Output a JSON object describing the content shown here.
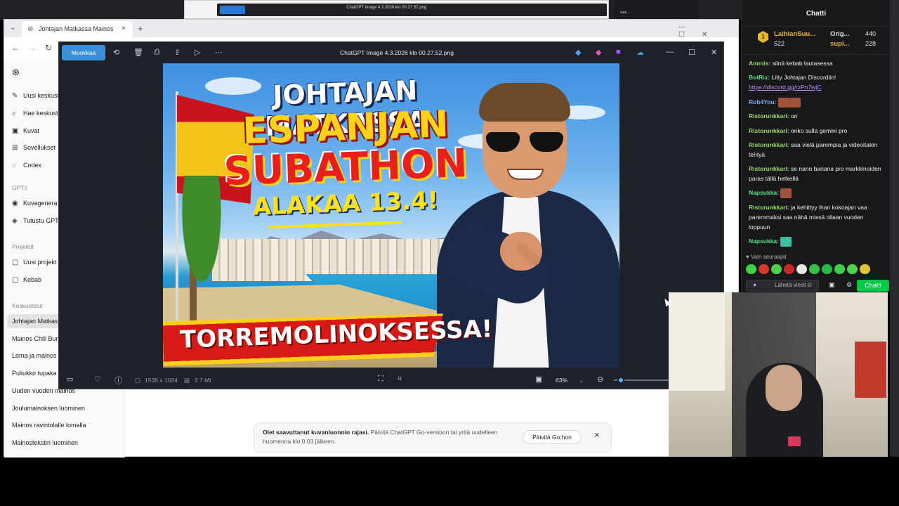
{
  "browser": {
    "tab_title": "Johtajan Matkassa Mainos",
    "tab_close": "×",
    "new_tab": "+",
    "nav": {
      "back": "←",
      "forward": "→",
      "reload": "↻"
    }
  },
  "sidebar": {
    "logo": "⊛",
    "items": [
      {
        "icon": "✎",
        "label": "Uusi keskustelu"
      },
      {
        "icon": "⌕",
        "label": "Hae keskusteluja"
      },
      {
        "icon": "▣",
        "label": "Kuvat"
      },
      {
        "icon": "⊞",
        "label": "Sovellukset"
      },
      {
        "icon": "◌",
        "label": "Codex"
      }
    ],
    "gpts_heading": "GPT:t",
    "gpts": [
      {
        "icon": "◉",
        "label": "Kuvagenera"
      },
      {
        "icon": "◈",
        "label": "Tutustu GPT"
      }
    ],
    "projects_heading": "Projektit",
    "projects": [
      {
        "icon": "▢",
        "label": "Uusi projekt"
      },
      {
        "icon": "▢",
        "label": "Kebab"
      }
    ],
    "chats_heading": "Keskustelut",
    "chats": [
      "Johtajan Matkas",
      "Mainos Chili Bur",
      "Loma ja mainos",
      "Puliukko tupaka",
      "Uuden vuoden mainos",
      "Joulumainoksen luominen",
      "Mainos ravintolalle lomalla",
      "Mainostekstin luominen"
    ]
  },
  "notice": {
    "bold": "Olet saavuttanut kuvanluonnin rajasi.",
    "text": "Päivitä ChatGPT Go-versioon tai yritä uudelleen huomenna klo 0.03 jälkeen.",
    "button": "Päivitä Go:hon",
    "close": "×"
  },
  "viewer": {
    "edit_button": "Muokkaa",
    "title": "ChatGPT Image 4.3.2026 klo 00.27.52.png",
    "dimensions": "1536 x 1024",
    "size": "2.7 Mt",
    "zoom": "63%",
    "zoom_fraction": 0.63
  },
  "thumbnail": {
    "line1": "JOHTAJAN MATKASSA",
    "line2": "ESPANJAN",
    "line3": "SUBATHON",
    "line4": "ALAKAA 13.4!",
    "line5": "TORREMOLINOKSESSA!"
  },
  "mini_window": {
    "title": "ChatGPT Image 4.3.2026 klo 00.27.52.png",
    "btn": "Muokkaa"
  },
  "chat": {
    "title": "Chatti",
    "leaders": [
      {
        "name": "LaihianSuu...",
        "count": "522",
        "rank": "1"
      },
      {
        "name": "Orig...",
        "count": "440"
      },
      {
        "name": "supi...",
        "count": "228"
      }
    ],
    "messages": [
      {
        "user": "Ammis:",
        "user_color": "#9ad86b",
        "text": "siinä kebab lautasessa"
      },
      {
        "user": "BotRix:",
        "user_color": "#4fe08a",
        "text": "Liity Johtajan Discordiin!",
        "link": "https://discord.gg/rzPn7wjC"
      },
      {
        "user": "Rob4You:",
        "user_color": "#7aa7ff",
        "text": ""
      },
      {
        "user": "Ristorunkkari:",
        "user_color": "#9ad86b",
        "text": "on"
      },
      {
        "user": "Ristorunkkari:",
        "user_color": "#9ad86b",
        "text": "onko sulla gemini pro"
      },
      {
        "user": "Ristorunkkari:",
        "user_color": "#9ad86b",
        "text": "saa vielä parempia ja videoitakin tehtyä"
      },
      {
        "user": "Ristorunkkari:",
        "user_color": "#9ad86b",
        "text": "se nano banana pro markkinoiden paras tällä hetkellä"
      },
      {
        "user": "Napsukka:",
        "user_color": "#4fe08a",
        "text": ""
      },
      {
        "user": "Ristorunkkari:",
        "user_color": "#9ad86b",
        "text": "ja kehittyy ihan kokoajan vaa paremmaksi saa nähä missä ollaan vuoden loppuun"
      },
      {
        "user": "Napsukka:",
        "user_color": "#4fe08a",
        "text": ""
      }
    ],
    "followers_only": "♥ Vain seuraajat",
    "input_placeholder": "Lähetä viesti",
    "send_button": "Chatti"
  }
}
